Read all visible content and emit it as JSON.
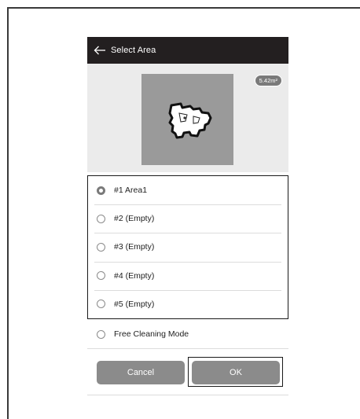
{
  "header": {
    "title": "Select Area",
    "back_icon": "arrow-left-icon"
  },
  "map": {
    "area_badge": "5.42m²",
    "map_color": "#9a9a9a"
  },
  "areas": [
    {
      "label": "#1 Area1",
      "selected": true
    },
    {
      "label": "#2 (Empty)",
      "selected": false
    },
    {
      "label": "#3 (Empty)",
      "selected": false
    },
    {
      "label": "#4 (Empty)",
      "selected": false
    },
    {
      "label": "#5 (Empty)",
      "selected": false
    }
  ],
  "free_mode": {
    "label": "Free Cleaning Mode",
    "selected": false
  },
  "buttons": {
    "cancel_label": "Cancel",
    "ok_label": "OK",
    "button_color": "#8b8b8b"
  },
  "colors": {
    "titlebar": "#231f20",
    "map_background": "#ebebeb"
  }
}
